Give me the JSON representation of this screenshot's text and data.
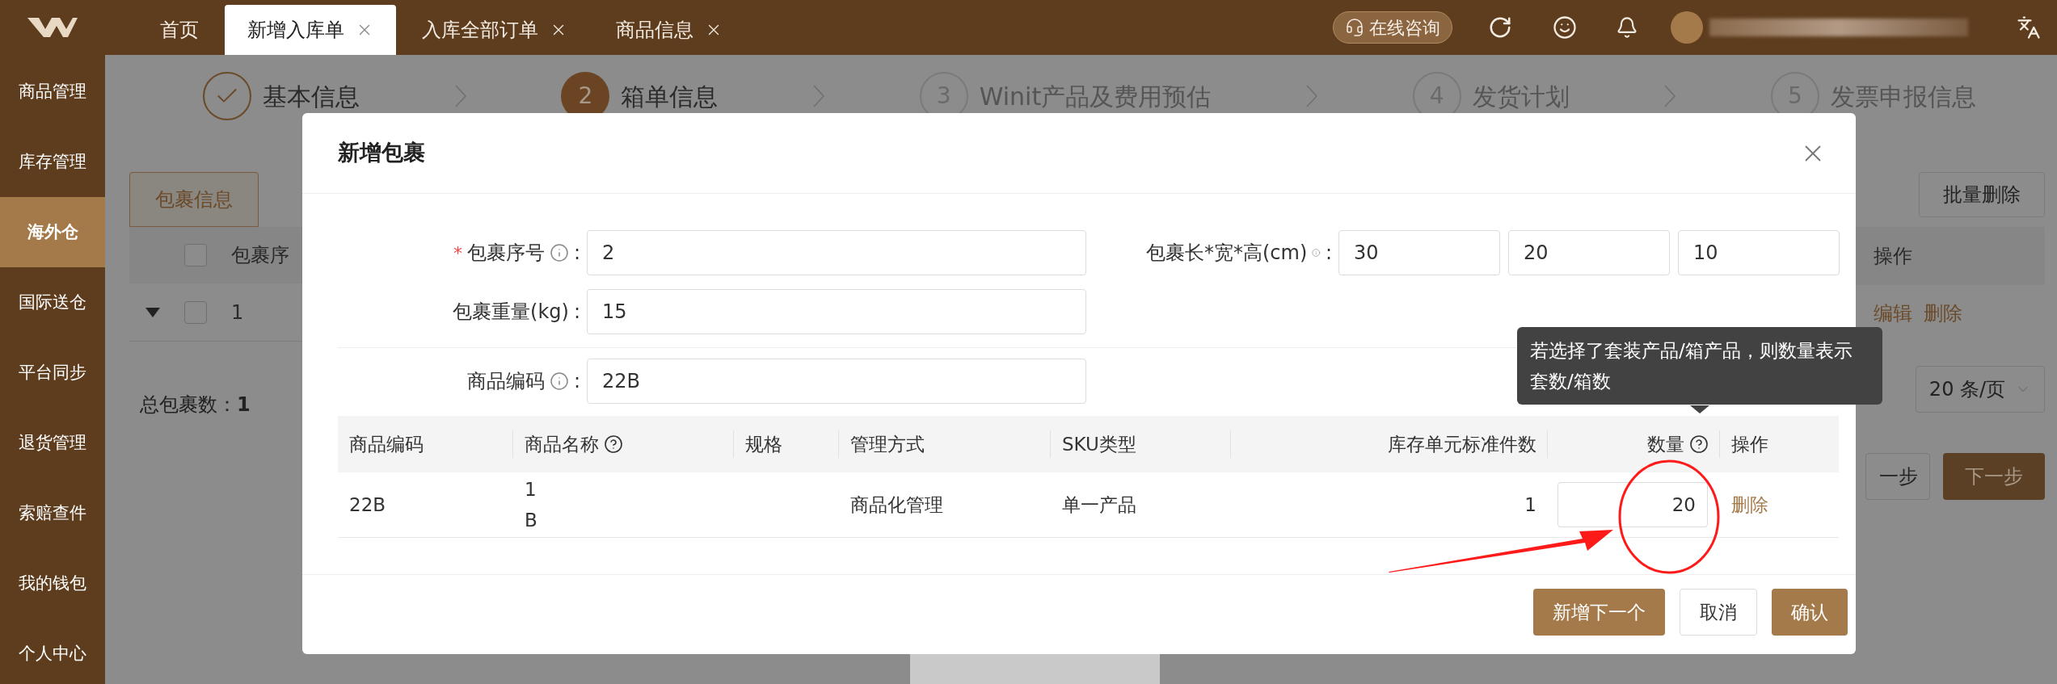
{
  "top_bar": {
    "tabs": [
      {
        "label": "首页",
        "closable": false,
        "selected": false
      },
      {
        "label": "新增入库单",
        "closable": true,
        "selected": true
      },
      {
        "label": "入库全部订单",
        "closable": true,
        "selected": false
      },
      {
        "label": "商品信息",
        "closable": true,
        "selected": false
      }
    ],
    "consult_button": "在线咨询"
  },
  "sidebar": {
    "items": [
      {
        "label": "商品管理",
        "selected": false
      },
      {
        "label": "库存管理",
        "selected": false
      },
      {
        "label": "海外仓",
        "selected": true
      },
      {
        "label": "国际送仓",
        "selected": false
      },
      {
        "label": "平台同步",
        "selected": false
      },
      {
        "label": "退货管理",
        "selected": false
      },
      {
        "label": "索赔查件",
        "selected": false
      },
      {
        "label": "我的钱包",
        "selected": false
      },
      {
        "label": "个人中心",
        "selected": false
      }
    ]
  },
  "steps": [
    {
      "label": "基本信息",
      "completed": true,
      "selected": false
    },
    {
      "number": "2",
      "label": "箱单信息",
      "completed": false,
      "selected": true
    },
    {
      "number": "3",
      "label": "Winit产品及费用预估",
      "completed": false,
      "selected": false
    },
    {
      "number": "4",
      "label": "发货计划",
      "completed": false,
      "selected": false
    },
    {
      "number": "5",
      "label": "发票申报信息",
      "completed": false,
      "selected": false
    }
  ],
  "background": {
    "tabs": [
      {
        "label": "包裹信息",
        "selected": true
      }
    ],
    "table": {
      "columns": [
        "包裹序"
      ],
      "rows": [
        {
          "cells": [
            "1"
          ],
          "expanded": true,
          "checked": false
        }
      ]
    },
    "header_checked": false,
    "summary_label": "总包裹数：",
    "summary_value": "1",
    "batch_delete": "批量删除",
    "actions_column": "操作",
    "row_actions": [
      "编辑",
      "删除"
    ],
    "page_size": "20 条/页",
    "prev_button": "一步",
    "next_button": "下一步"
  },
  "dialog": {
    "title": "新增包裹",
    "separator": ":",
    "required_mark": "*",
    "fields": [
      {
        "label": "包裹序号",
        "required": true,
        "info": true,
        "values": [
          "2"
        ]
      },
      {
        "label": "包裹长*宽*高(cm)",
        "required": false,
        "info": true,
        "values": [
          "30",
          "20",
          "10"
        ]
      },
      {
        "label": "包裹重量(kg)",
        "required": false,
        "info": false,
        "values": [
          "15"
        ]
      },
      {
        "label": "商品编码",
        "required": false,
        "info": true,
        "values": [
          "22B"
        ]
      }
    ],
    "table": {
      "columns": [
        {
          "label": "商品编码",
          "help": false
        },
        {
          "label": "商品名称",
          "help": true
        },
        {
          "label": "规格",
          "help": false
        },
        {
          "label": "管理方式",
          "help": false
        },
        {
          "label": "SKU类型",
          "help": false
        },
        {
          "label": "库存单元标准件数",
          "help": false
        },
        {
          "label": "数量",
          "help": true
        },
        {
          "label": "操作",
          "help": false
        }
      ],
      "rows": [
        {
          "code": "22B",
          "name": [
            "1",
            "B"
          ],
          "management": "商品化管理",
          "sku_type": "单一产品",
          "units": "1",
          "quantity": "20",
          "action": "删除"
        }
      ]
    },
    "buttons": [
      {
        "label": "新增下一个",
        "kind": "primary"
      },
      {
        "label": "取消",
        "kind": "default"
      },
      {
        "label": "确认",
        "kind": "primary"
      }
    ],
    "tooltip": "若选择了套装产品/箱产品，则数量表示套数/箱数"
  }
}
